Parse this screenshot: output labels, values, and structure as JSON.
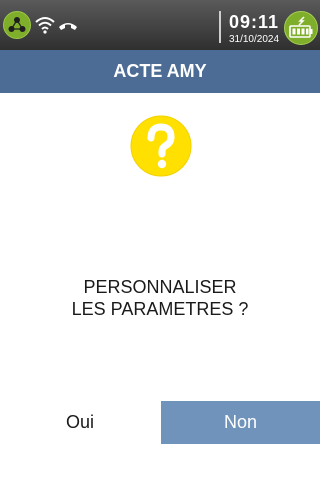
{
  "status_bar": {
    "time": "09:11",
    "date": "31/10/2024",
    "icons": [
      "network-icon",
      "wifi-icon",
      "phone-hangup-icon",
      "battery-charging-icon"
    ],
    "badge_color": "#7fae2a"
  },
  "header": {
    "title": "ACTE AMY",
    "color": "#4c6c95"
  },
  "dialog": {
    "icon": "question-icon",
    "icon_color": "#ffe000",
    "lines": [
      "PERSONNALISER",
      "LES PARAMETRES ?"
    ]
  },
  "buttons": {
    "yes_label": "Oui",
    "no_label": "Non",
    "selected": "Non",
    "selected_color": "#6f93bb"
  }
}
